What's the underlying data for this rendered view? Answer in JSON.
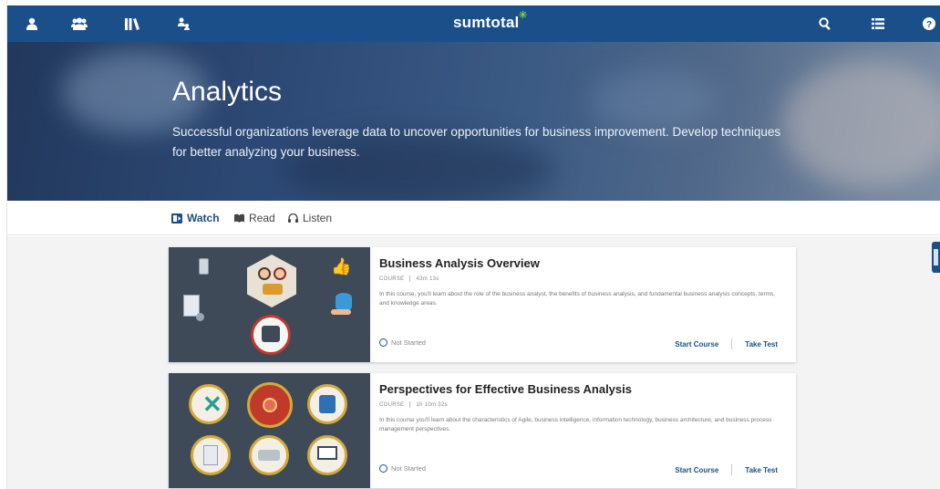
{
  "header": {
    "brand": "sumtotal",
    "brand_accent": "#1b4f8a",
    "left_icons": [
      "user-icon",
      "team-icon",
      "library-icon",
      "org-chart-icon"
    ],
    "right_icons": [
      "search-icon",
      "list-icon",
      "help-icon"
    ]
  },
  "hero": {
    "title": "Analytics",
    "description": "Successful organizations leverage data to uncover opportunities for business improvement. Develop techniques for better analyzing your business."
  },
  "tabs": [
    {
      "label": "Watch",
      "icon": "video-icon",
      "active": true
    },
    {
      "label": "Read",
      "icon": "book-icon",
      "active": false
    },
    {
      "label": "Listen",
      "icon": "headphones-icon",
      "active": false
    }
  ],
  "courses": [
    {
      "title": "Business Analysis Overview",
      "type": "COURSE",
      "duration": "43m 13s",
      "description": "In this course, you'll learn about the role of the business analyst, the benefits of business analysis, and fundamental business analysis concepts, terms, and knowledge areas.",
      "status": "Not Started",
      "start_label": "Start Course",
      "test_label": "Take Test"
    },
    {
      "title": "Perspectives for Effective Business Analysis",
      "type": "COURSE",
      "duration": "1h 10m 32s",
      "description": "In this course you'll learn about the characteristics of Agile, business intelligence, information technology, business architecture, and business process management perspectives.",
      "status": "Not Started",
      "start_label": "Start Course",
      "test_label": "Take Test"
    }
  ]
}
